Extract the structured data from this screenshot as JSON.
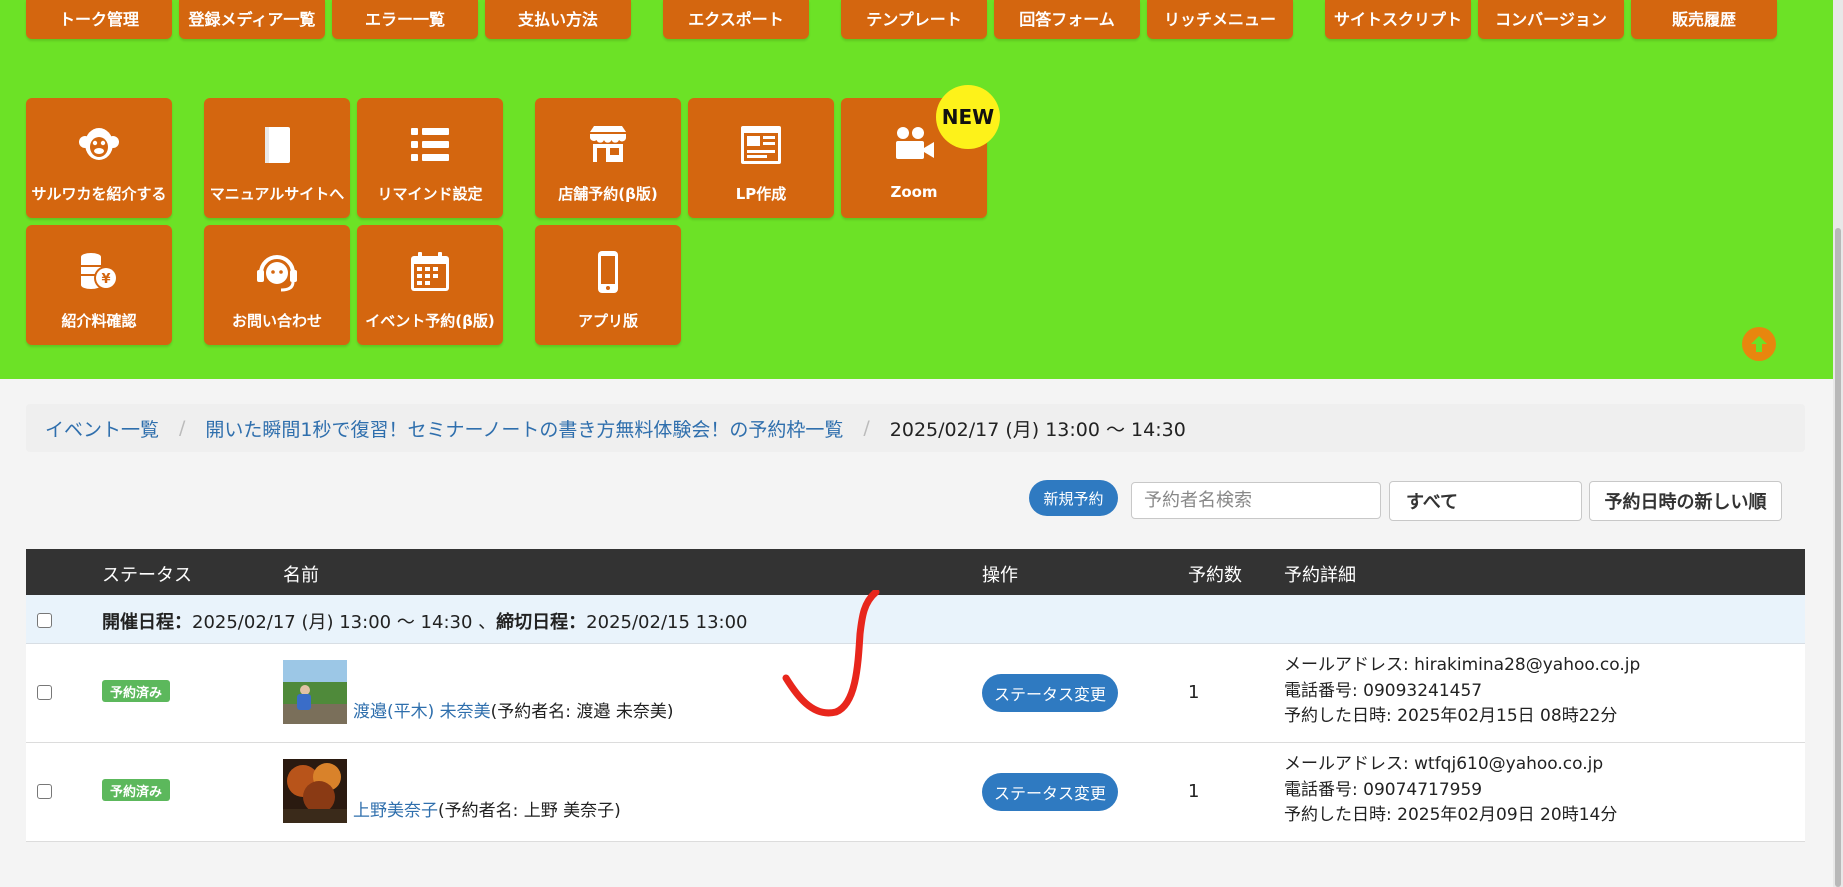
{
  "menu": {
    "top_buttons": [
      "トーク管理",
      "登録メディア一覧",
      "エラー一覧",
      "支払い方法",
      "エクスポート",
      "テンプレート",
      "回答フォーム",
      "リッチメニュー",
      "サイトスクリプト",
      "コンバージョン",
      "販売履歴"
    ],
    "tiles": [
      {
        "label": "サルワカを紹介する",
        "icon": "monkey-icon"
      },
      {
        "label": "マニュアルサイトへ",
        "icon": "book-icon"
      },
      {
        "label": "リマインド設定",
        "icon": "list-icon"
      },
      {
        "label": "店舗予約(β版)",
        "icon": "store-icon"
      },
      {
        "label": "LP作成",
        "icon": "browser-window-icon"
      },
      {
        "label": "Zoom",
        "icon": "video-camera-icon"
      },
      {
        "label": "紹介料確認",
        "icon": "coins-icon"
      },
      {
        "label": "お問い合わせ",
        "icon": "headset-icon"
      },
      {
        "label": "イベント予約(β版)",
        "icon": "calendar-icon"
      },
      {
        "label": "アプリ版",
        "icon": "smartphone-icon"
      }
    ],
    "new_badge": "NEW"
  },
  "breadcrumb": {
    "items": [
      "イベント一覧",
      "開いた瞬間1秒で復習！セミナーノートの書き方無料体験会！の予約枠一覧"
    ],
    "current": "2025/02/17 (月) 13:00 〜 14:30",
    "separator": "/"
  },
  "toolbar": {
    "new_reservation": "新規予約",
    "search_placeholder": "予約者名検索",
    "filter_value": "すべて",
    "sort_label": "予約日時の新しい順"
  },
  "table": {
    "headers": {
      "status": "ステータス",
      "name": "名前",
      "action": "操作",
      "count": "予約数",
      "details": "予約詳細"
    },
    "group": {
      "event_label": "開催日程：",
      "event_value": "2025/02/17 (月) 13:00 〜 14:30",
      "sep": "、",
      "deadline_label": "締切日程：",
      "deadline_value": "2025/02/15 13:00"
    },
    "rows": [
      {
        "status": "予約済み",
        "name": "渡邉(平木) 未奈美",
        "booker": "(予約者名: 渡邉 未奈美)",
        "action": "ステータス変更",
        "count": "1",
        "email": "メールアドレス: hirakimina28@yahoo.co.jp",
        "phone": "電話番号: 09093241457",
        "booked_at": "予約した日時: 2025年02月15日 08時22分"
      },
      {
        "status": "予約済み",
        "name": "上野美奈子",
        "booker": "(予約者名: 上野 美奈子)",
        "action": "ステータス変更",
        "count": "1",
        "email": "メールアドレス: wtfqj610@yahoo.co.jp",
        "phone": "電話番号: 09074717959",
        "booked_at": "予約した日時: 2025年02月09日 20時14分"
      }
    ]
  },
  "colors": {
    "menu_bg": "#6ce226",
    "menu_button": "#d4660f",
    "new_badge": "#fdf21a",
    "primary": "#2f7ac1",
    "status_badge": "#5cb85c",
    "table_header": "#333333",
    "annotation": "#e8261c"
  }
}
